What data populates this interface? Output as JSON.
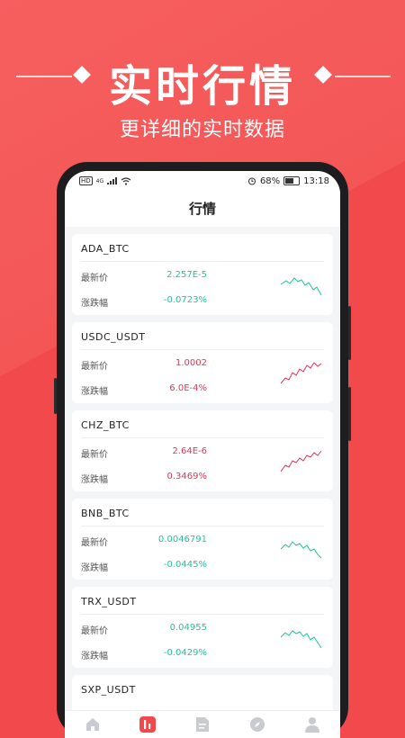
{
  "hero": {
    "title": "实时行情",
    "subtitle": "更详细的实时数据"
  },
  "status_bar": {
    "hd": "HD",
    "network": "4G",
    "battery": "68%",
    "time": "13:18"
  },
  "header": {
    "title": "行情"
  },
  "labels": {
    "price": "最新价",
    "change": "涨跌幅"
  },
  "markets": [
    {
      "symbol": "ADA_BTC",
      "price": "2.257E-5",
      "change": "-0.0723%",
      "trend": "down"
    },
    {
      "symbol": "USDC_USDT",
      "price": "1.0002",
      "change": "6.0E-4%",
      "trend": "up"
    },
    {
      "symbol": "CHZ_BTC",
      "price": "2.64E-6",
      "change": "0.3469%",
      "trend": "up"
    },
    {
      "symbol": "BNB_BTC",
      "price": "0.0046791",
      "change": "-0.0445%",
      "trend": "down"
    },
    {
      "symbol": "TRX_USDT",
      "price": "0.04955",
      "change": "-0.0429%",
      "trend": "down"
    },
    {
      "symbol": "SXP_USDT"
    }
  ],
  "tabbar": {
    "icons": [
      "home-icon",
      "market-icon",
      "document-icon",
      "compass-icon",
      "user-icon"
    ],
    "active": 1
  },
  "colors": {
    "up": "#e13553",
    "down": "#1fc3a0",
    "brand": "#f24a4c"
  }
}
